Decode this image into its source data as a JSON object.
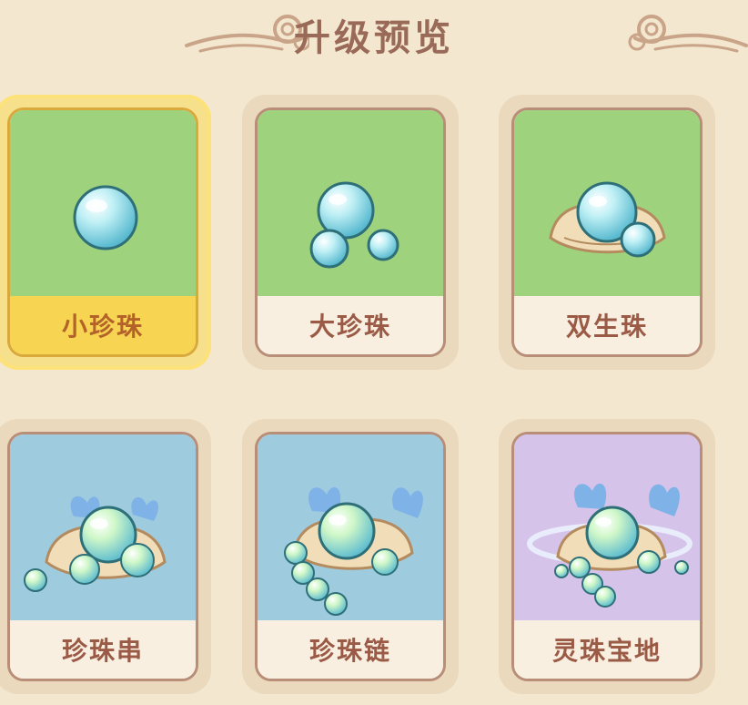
{
  "header": {
    "title": "升级预览",
    "left_ornament_icon": "cloud-ornament-icon",
    "right_ornament_icon": "cloud-ornament-icon"
  },
  "colors": {
    "page_bg": "#f3e7cf",
    "title": "#9a6a58",
    "card_border": "#b98e78",
    "green_bg": "#9fd27d",
    "blue_bg": "#9ecbde",
    "purple_bg": "#d6c3ea",
    "selected_label_bg": "#f7d451"
  },
  "upgrades": [
    {
      "name": "小珍珠",
      "icon": "small-pearl-icon",
      "theme": "green",
      "selected": true
    },
    {
      "name": "大珍珠",
      "icon": "big-pearl-icon",
      "theme": "green",
      "selected": false
    },
    {
      "name": "双生珠",
      "icon": "twin-pearl-shell-icon",
      "theme": "green",
      "selected": false
    },
    {
      "name": "珍珠串",
      "icon": "pearl-string-shell-icon",
      "theme": "blue",
      "selected": false
    },
    {
      "name": "珍珠链",
      "icon": "pearl-chain-shell-icon",
      "theme": "blue",
      "selected": false
    },
    {
      "name": "灵珠宝地",
      "icon": "spirit-pearl-treasure-icon",
      "theme": "purple",
      "selected": false
    }
  ]
}
